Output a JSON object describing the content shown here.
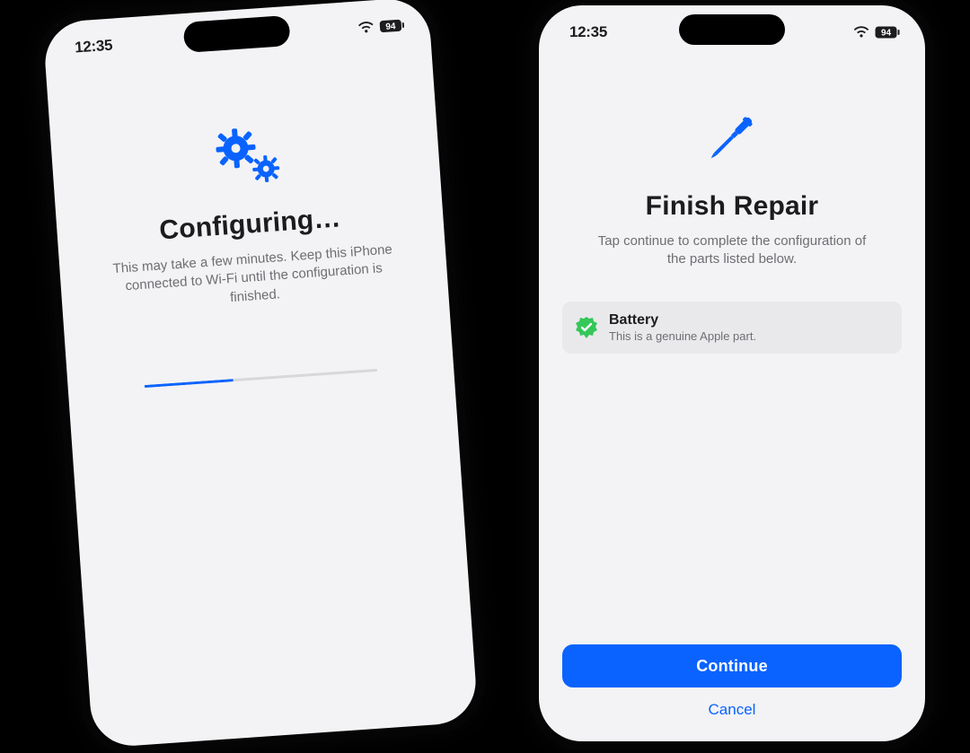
{
  "status": {
    "time": "12:35",
    "battery_percent": "94"
  },
  "left": {
    "title": "Configuring…",
    "subtitle": "This may take a few minutes. Keep this iPhone connected to Wi-Fi until the configuration is finished.",
    "progress_percent": 38
  },
  "right": {
    "title": "Finish Repair",
    "subtitle": "Tap continue to complete the configuration of the parts listed below.",
    "part": {
      "name": "Battery",
      "detail": "This is a genuine Apple part."
    },
    "continue_label": "Continue",
    "cancel_label": "Cancel"
  },
  "colors": {
    "accent": "#0a63ff",
    "verify_green": "#34c759"
  }
}
